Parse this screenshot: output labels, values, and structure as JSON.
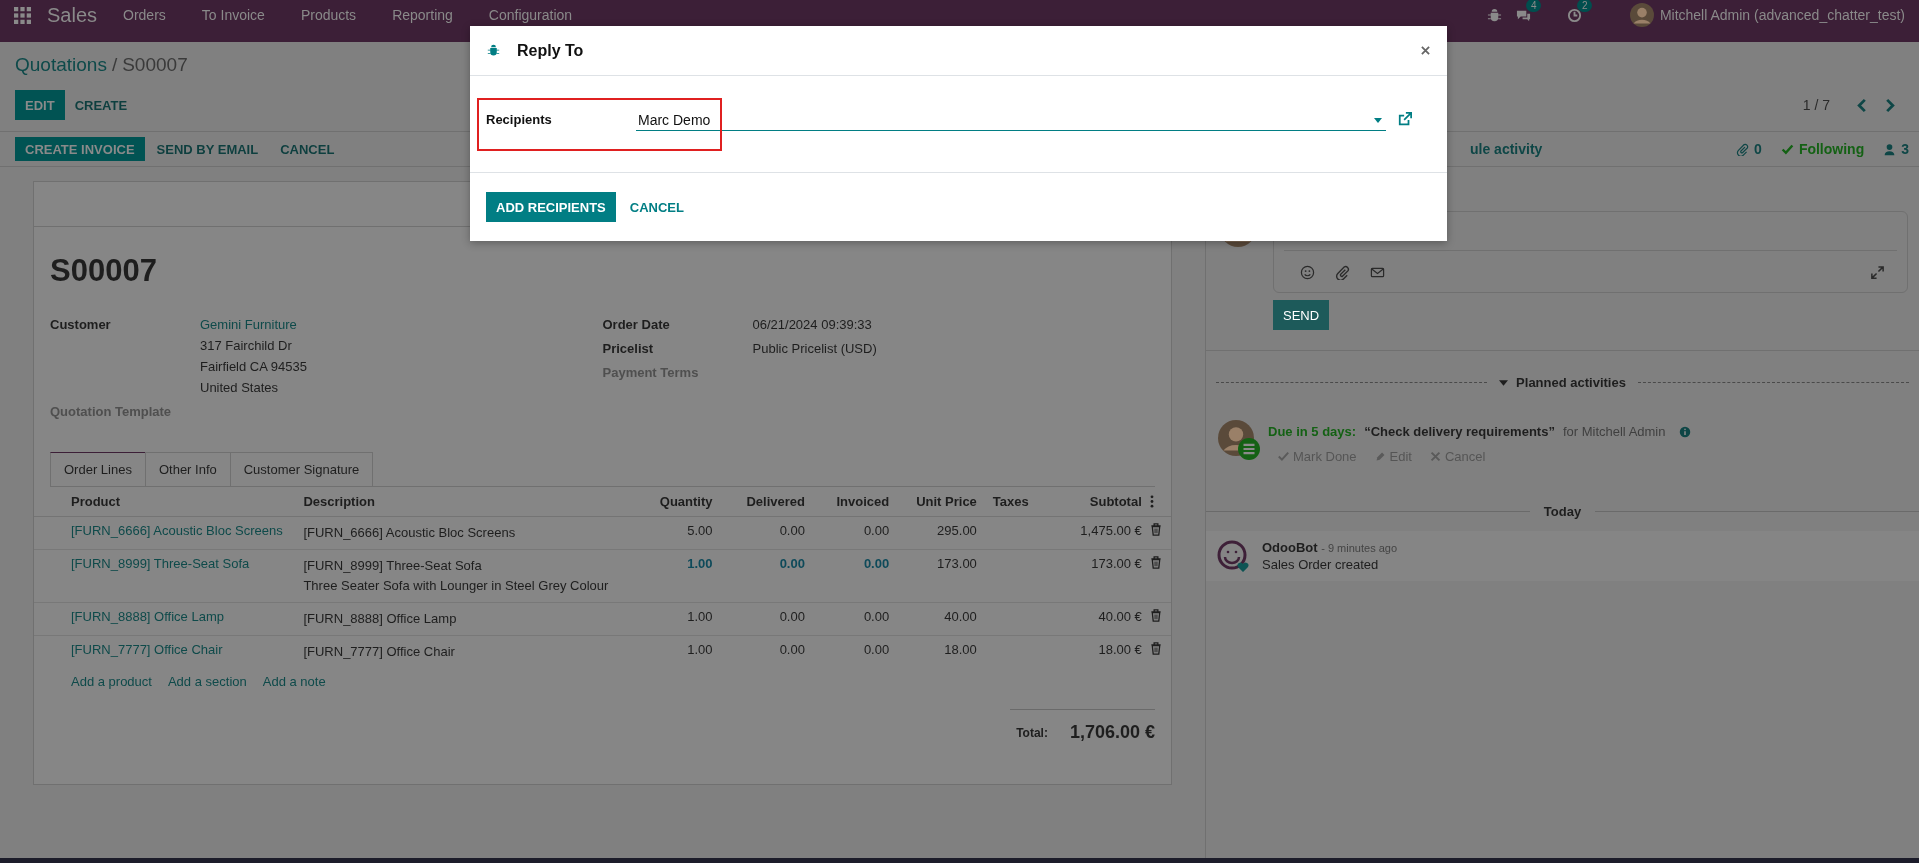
{
  "navbar": {
    "app": "Sales",
    "menu": [
      "Orders",
      "To Invoice",
      "Products",
      "Reporting",
      "Configuration"
    ],
    "chat_count": "4",
    "activity_count": "2",
    "user": "Mitchell Admin (advanced_chatter_test)"
  },
  "breadcrumb": {
    "parent": "Quotations",
    "separator": "/",
    "current": "S00007"
  },
  "actions": [
    {
      "label": "EDIT",
      "kind": "primary"
    },
    {
      "label": "CREATE",
      "kind": "secondary"
    }
  ],
  "pager": "1 / 7",
  "status_buttons": [
    {
      "label": "CREATE INVOICE",
      "kind": "primary"
    },
    {
      "label": "SEND BY EMAIL",
      "kind": "secondary"
    },
    {
      "label": "CANCEL",
      "kind": "secondary"
    }
  ],
  "chatter_topbar": {
    "schedule": "ule activity",
    "attachments": "0",
    "follow": "Following",
    "followers": "3"
  },
  "form": {
    "title": "S00007",
    "left_fields": [
      {
        "label": "Customer",
        "muted": false,
        "link": "Gemini Furniture",
        "lines": [
          "317 Fairchild Dr",
          "Fairfield CA 94535",
          "United States"
        ]
      },
      {
        "label": "Quotation Template",
        "muted": true
      }
    ],
    "right_fields": [
      {
        "label": "Order Date",
        "muted": false,
        "lines": [
          "06/21/2024 09:39:33"
        ]
      },
      {
        "label": "Pricelist",
        "muted": false,
        "lines": [
          "Public Pricelist (USD)"
        ]
      },
      {
        "label": "Payment Terms",
        "muted": true
      }
    ],
    "tabs": [
      {
        "label": "Order Lines",
        "selected": true
      },
      {
        "label": "Other Info",
        "selected": false
      },
      {
        "label": "Customer Signature",
        "selected": false
      }
    ],
    "columns": [
      "Product",
      "Description",
      "Quantity",
      "Delivered",
      "Invoiced",
      "Unit Price",
      "Taxes",
      "Subtotal"
    ],
    "rows": [
      {
        "product": "[FURN_6666] Acoustic Bloc Screens",
        "description": [
          "[FURN_6666] Acoustic Bloc Screens"
        ],
        "quantity": "5.00",
        "delivered": "0.00",
        "invoiced": "0.00",
        "unit_price": "295.00",
        "subtotal": "1,475.00 €",
        "emphasis": false
      },
      {
        "product": "[FURN_8999] Three-Seat Sofa",
        "description": [
          "[FURN_8999] Three-Seat Sofa",
          "Three Seater Sofa with Lounger in Steel Grey Colour"
        ],
        "quantity": "1.00",
        "delivered": "0.00",
        "invoiced": "0.00",
        "unit_price": "173.00",
        "subtotal": "173.00 €",
        "emphasis": true
      },
      {
        "product": "[FURN_8888] Office Lamp",
        "description": [
          "[FURN_8888] Office Lamp"
        ],
        "quantity": "1.00",
        "delivered": "0.00",
        "invoiced": "0.00",
        "unit_price": "40.00",
        "subtotal": "40.00 €",
        "emphasis": false
      },
      {
        "product": "[FURN_7777] Office Chair",
        "description": [
          "[FURN_7777] Office Chair"
        ],
        "quantity": "1.00",
        "delivered": "0.00",
        "invoiced": "0.00",
        "unit_price": "18.00",
        "subtotal": "18.00 €",
        "emphasis": false
      }
    ],
    "add_links": [
      "Add a product",
      "Add a section",
      "Add a note"
    ],
    "total_label": "Total:",
    "total": "1,706.00 €"
  },
  "chatter": {
    "send": "SEND",
    "planned_title": "Planned activities",
    "activity": {
      "due": "Due in 5 days:",
      "summary": "“Check delivery requirements”",
      "for": "for Mitchell Admin",
      "actions": [
        "Mark Done",
        "Edit",
        "Cancel"
      ]
    },
    "separator": "Today",
    "message": {
      "author": "OdooBot",
      "time": "- 9 minutes ago",
      "body": "Sales Order created"
    }
  },
  "dialog": {
    "title": "Reply To",
    "field_label": "Recipients",
    "field_value": "Marc Demo",
    "buttons": [
      {
        "label": "ADD RECIPIENTS",
        "kind": "primary"
      },
      {
        "label": "CANCEL",
        "kind": "secondary"
      }
    ]
  }
}
